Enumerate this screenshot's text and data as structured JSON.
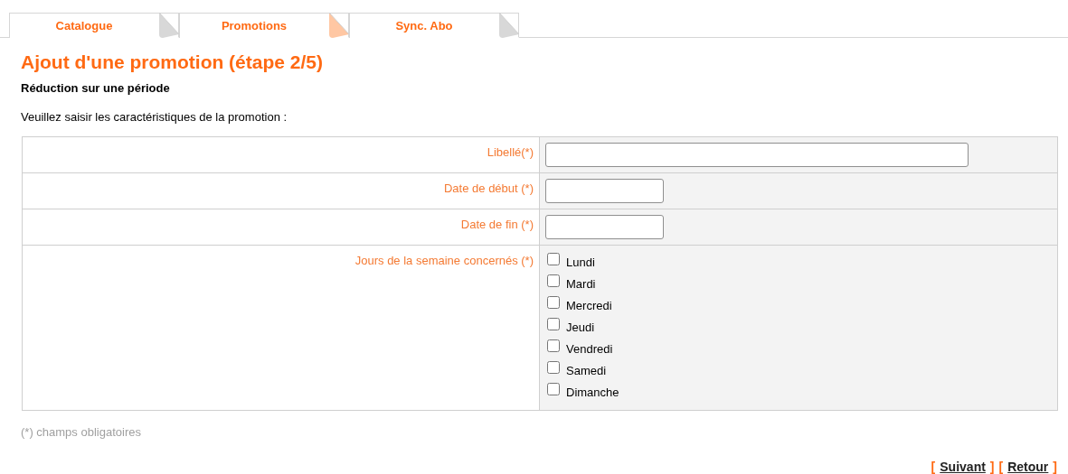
{
  "tabs": [
    {
      "label": "Catalogue",
      "selected": false
    },
    {
      "label": "Promotions",
      "selected": true
    },
    {
      "label": "Sync. Abo",
      "selected": false
    }
  ],
  "title": "Ajout d'une promotion (étape 2/5)",
  "subtitle": "Réduction sur une période",
  "intro": "Veuillez saisir les caractéristiques de la promotion :",
  "form": {
    "rows": [
      {
        "label": "Libellé(*)",
        "kind": "text"
      },
      {
        "label": "Date de début (*)",
        "kind": "date"
      },
      {
        "label": "Date de fin (*)",
        "kind": "date"
      },
      {
        "label": "Jours de la semaine concernés (*)",
        "kind": "checkboxes",
        "options": [
          {
            "label": "Lundi",
            "checked": false
          },
          {
            "label": "Mardi",
            "checked": false
          },
          {
            "label": "Mercredi",
            "checked": false
          },
          {
            "label": "Jeudi",
            "checked": false
          },
          {
            "label": "Vendredi",
            "checked": false
          },
          {
            "label": "Samedi",
            "checked": false
          },
          {
            "label": "Dimanche",
            "checked": false
          }
        ]
      }
    ]
  },
  "footnote": "(*) champs obligatoires",
  "nav_links": [
    {
      "open": "[",
      "label": "Suivant",
      "close": "]"
    },
    {
      "open": "[",
      "label": "Retour",
      "close": "]"
    }
  ]
}
